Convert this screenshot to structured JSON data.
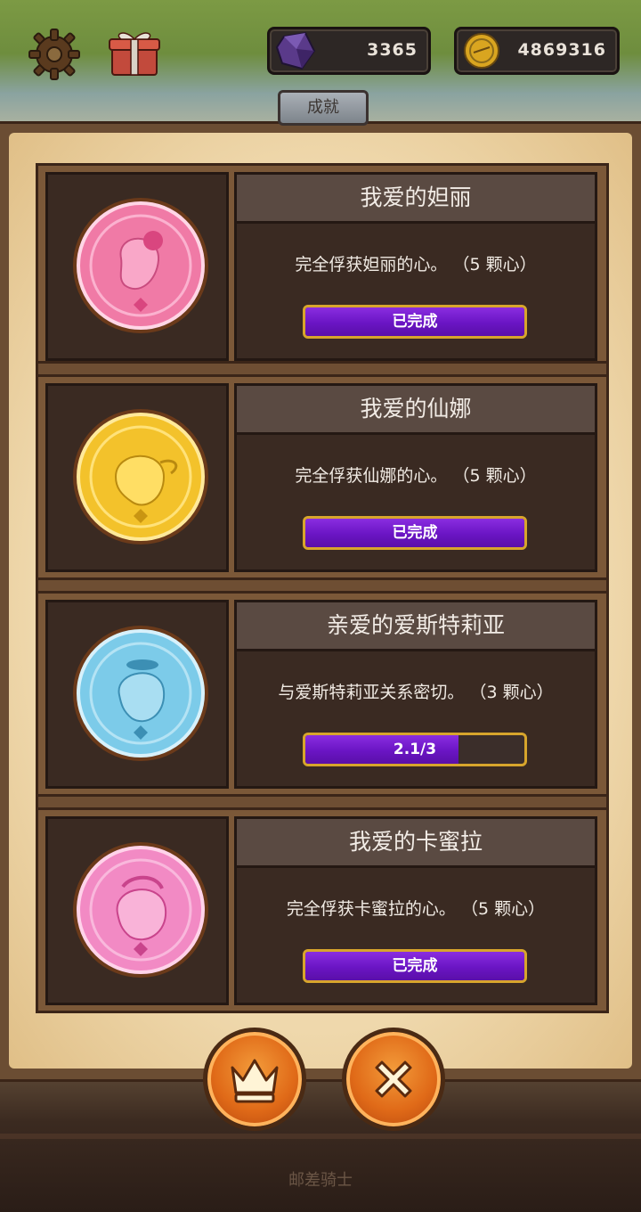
{
  "app": {
    "footer": "邮差骑士"
  },
  "currencies": {
    "gems": "3365",
    "coins": "4869316"
  },
  "tab": {
    "title": "成就"
  },
  "achievements": [
    {
      "title": "我爱的妲丽",
      "description": "完全俘获妲丽的心。 （5 颗心）",
      "status": "已完成",
      "progress": 1.0,
      "medal_color": "#f07aa6"
    },
    {
      "title": "我爱的仙娜",
      "description": "完全俘获仙娜的心。 （5 颗心）",
      "status": "已完成",
      "progress": 1.0,
      "medal_color": "#f3c22b"
    },
    {
      "title": "亲爱的爱斯特莉亚",
      "description": "与爱斯特莉亚关系密切。 （3 颗心）",
      "status": "2.1/3",
      "progress": 0.7,
      "medal_color": "#7ccbe9"
    },
    {
      "title": "我爱的卡蜜拉",
      "description": "完全俘获卡蜜拉的心。 （5 颗心）",
      "status": "已完成",
      "progress": 1.0,
      "medal_color": "#f28ac4"
    }
  ],
  "icons": {
    "settings": "gear-icon",
    "gift": "gift-icon",
    "gem": "gem-icon",
    "coin": "coin-icon",
    "crown": "crown-icon",
    "close": "close-icon"
  }
}
